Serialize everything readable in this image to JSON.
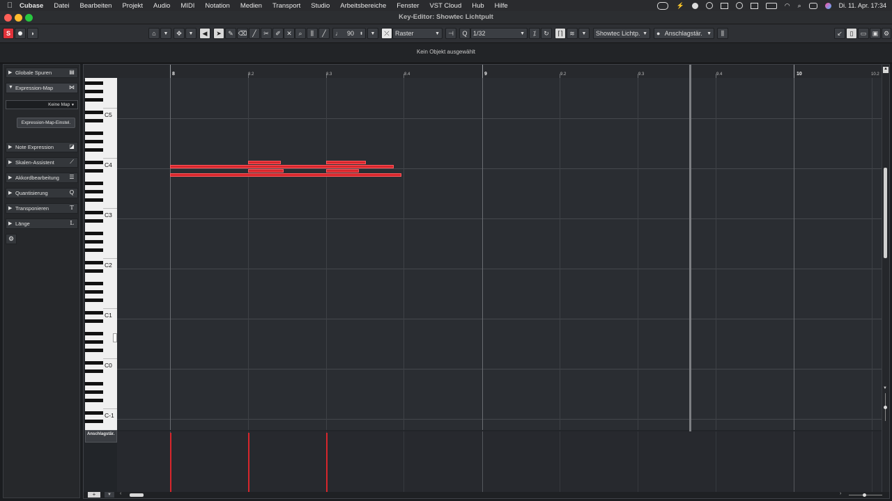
{
  "menubar": {
    "apple_icon": "",
    "items": [
      "Cubase",
      "Datei",
      "Bearbeiten",
      "Projekt",
      "Audio",
      "MIDI",
      "Notation",
      "Medien",
      "Transport",
      "Studio",
      "Arbeitsbereiche",
      "Fenster",
      "VST Cloud",
      "Hub",
      "Hilfe"
    ],
    "datetime": "Di. 11. Apr.  17:34"
  },
  "window": {
    "title": "Key-Editor: Showtec Lichtpult"
  },
  "toolbar": {
    "tempo_value": "90",
    "snap_label": "Raster",
    "quantize_value": "1/32",
    "track_select": "Showtec Lichtp.",
    "controller_select": "Anschlagstär."
  },
  "infoline": {
    "message": "Kein Objekt ausgewählt"
  },
  "inspector": {
    "sections": {
      "global_tracks": "Globale Spuren",
      "expression_map": "Expression-Map",
      "note_expression": "Note Expression",
      "scale_assistant": "Skalen-Assistent",
      "chord_editing": "Akkordbearbeitung",
      "quantize": "Quantisierung",
      "transpose": "Transponieren",
      "length": "Länge"
    },
    "map_select": "Keine Map",
    "map_settings_button": "Expression-Map-Einstel."
  },
  "ruler": {
    "bars": [
      "8",
      "9",
      "10"
    ],
    "beats": [
      "8.2",
      "8.3",
      "8.4",
      "9.2",
      "9.3",
      "9.4",
      "10.2"
    ]
  },
  "keyboard": {
    "octaves": [
      "C5",
      "C4",
      "C3",
      "C2",
      "C1",
      "C0",
      "C-1"
    ]
  },
  "controller_lane": {
    "label": "Anschlagstär."
  },
  "colors": {
    "note": "#d8262c",
    "accent_red": "#e0323a"
  }
}
